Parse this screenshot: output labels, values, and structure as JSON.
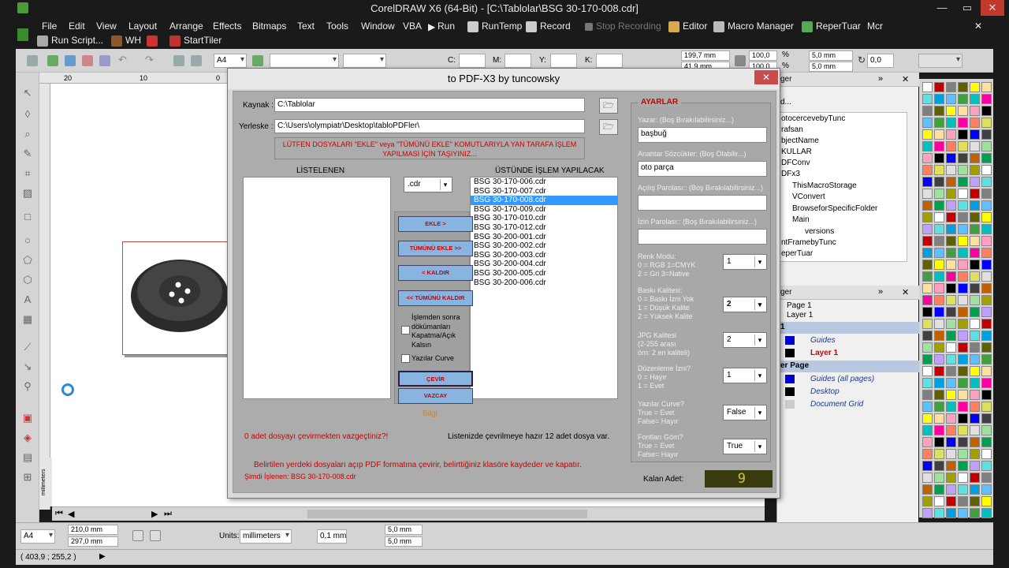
{
  "window": {
    "title": "CorelDRAW X6 (64-Bit) - [C:\\Tablolar\\BSG 30-170-008.cdr]"
  },
  "menu": {
    "items": [
      "File",
      "Edit",
      "View",
      "Layout",
      "Arrange",
      "Effects",
      "Bitmaps",
      "Text",
      "Tools",
      "Window",
      "VBA",
      "Run",
      "RunTemp",
      "Record",
      "Stop Recording",
      "Editor",
      "Macro Manager",
      "ReperTuar",
      "Mcr"
    ],
    "row2": [
      "Run Script...",
      "WH",
      "StartTiler"
    ]
  },
  "propbar": {
    "page_size": "A4",
    "width": "199,7 mm",
    "height": "41,9 mm",
    "scale1": "100,0",
    "scale2": "100,0",
    "nudge1": "5,0 mm",
    "nudge2": "5,0 mm",
    "angle": "0,0",
    "percent": "%",
    "x_label": "C:",
    "m_label": "M:",
    "y_label": "Y:",
    "k_label": "K:"
  },
  "ruler": {
    "t1": "20",
    "t2": "10",
    "t3": "0"
  },
  "bottombar": {
    "page": "A4",
    "w": "210,0 mm",
    "h": "297,0 mm",
    "units_label": "Units:",
    "units": "millimeters",
    "nudge": "0,1 mm",
    "dup1": "5,0 mm",
    "dup2": "5,0 mm",
    "ruler_units": "millimeters"
  },
  "status": {
    "coords": "( 403,9 ; 255,2 )"
  },
  "docker": {
    "tab1": "ger",
    "item_top": "d...",
    "macros": [
      "otocercevebyTunc",
      "rafsan",
      "bjectName",
      "KULLAR",
      "DFConv",
      "DFx3",
      "ThisMacroStorage",
      "VConvert",
      "BrowseforSpecificFolder",
      "Main",
      "versions",
      "ntFramebyTunc",
      "eperTuar"
    ],
    "tab2": "ger",
    "pages": [
      "Page 1",
      "Layer 1"
    ],
    "sec1": "1",
    "layers1": [
      "Guides",
      "Layer 1"
    ],
    "sec2": "er Page",
    "layers2": [
      "Guides (all pages)",
      "Desktop",
      "Document Grid"
    ]
  },
  "dialog": {
    "title": "to PDF-X3 by tuncowsky",
    "close": "✕",
    "kaynak_label": "Kaynak :",
    "kaynak_value": "C:\\Tablolar",
    "yerleske_label": "Yerleske :",
    "yerleske_value": "C:\\Users\\olympiatr\\Desktop\\tabloPDFler\\",
    "warning": "LÜTFEN DOSYALARI \"EKLE\" veya \"TÜMÜNÜ EKLE\" KOMUTLARIYLA YAN TARAFA İŞLEM YAPILMASI İÇİN TAŞIYINIZ...",
    "listed_label": "LİSTELENEN",
    "processing_label": "ÜSTÜNDE İŞLEM YAPILACAK",
    "filter": ".cdr",
    "files": [
      "BSG 30-170-006.cdr",
      "BSG 30-170-007.cdr",
      "BSG 30-170-008.cdr",
      "BSG 30-170-009.cdr",
      "BSG 30-170-010.cdr",
      "BSG 30-170-012.cdr",
      "BSG 30-200-001.cdr",
      "BSG 30-200-002.cdr",
      "BSG 30-200-003.cdr",
      "BSG 30-200-004.cdr",
      "BSG 30-200-005.cdr",
      "BSG 30-200-006.cdr"
    ],
    "selected_file": "BSG 30-170-008.cdr",
    "btn_add": "EKLE >",
    "btn_add_all": "TÜMÜNÜ EKLE >>",
    "btn_remove": "< KALDIR",
    "btn_remove_all": "<< TÜMÜNÜ KALDIR",
    "chk_close": "İşlemden sonra dökümanları Kapatma/Açık Kalsın",
    "chk_curve": "Yazılar Curve",
    "btn_convert": "ÇEVİR",
    "btn_cancel": "VAZCAY",
    "info_link": "Bilgi",
    "msg_cancel": "0 adet dosyayı çevirmekten vazgeçtiniz?!",
    "msg_ready": "Listenizde çevrilmeye hazır 12 adet dosya var.",
    "msg_desc": "Belirtilen yerdeki dosyaları açıp PDF formatına çevirir, belirttiğiniz klasöre kaydeder ve kapatır.",
    "msg_current": "Şimdi İşlenen: BSG 30-170-008.cdr",
    "settings": {
      "title": "AYARLAR",
      "author_label": "Yazar: (Boş Bırakılabilirsiniz...)",
      "author_value": "başbuğ",
      "keywords_label": "Anahtar Sözcükler: (Boş Olabilir...)",
      "keywords_value": "oto parça",
      "openpw_label": "Açılış Parolası:: (Boş Bırakılabilirsiniz...)",
      "openpw_value": "",
      "permpw_label": "İzin Parolası:: (Boş Bırakılabilirsiniz...)",
      "permpw_value": "",
      "color_label1": "Renk Modu:",
      "color_label2": "0 = RGB   1=CMYK",
      "color_label3": "2 = Gri     3=Native",
      "color_value": "1",
      "print_label1": "Baskı Kalitesi:",
      "print_label2": "0 = Baskı İzni Yok",
      "print_label3": "1 = Düşük Kalite",
      "print_label4": "2 = Yüksek Kalite",
      "print_value": "2",
      "jpg_label1": "JPG Kalitesi",
      "jpg_label2": "(2-255 arası",
      "jpg_label3": "örn: 2 en kaliteli)",
      "jpg_value": "2",
      "edit_label1": "Düzenleme İzni?",
      "edit_label2": "0 = Hayır",
      "edit_label3": "1 = Evet",
      "edit_value": "1",
      "curve_label1": "Yazılar Curve?",
      "curve_label2": "True = Evet",
      "curve_label3": "False= Hayır",
      "curve_value": "False",
      "font_label1": "Fontları Göm?",
      "font_label2": "True = Evet",
      "font_label3": "False= Hayır",
      "font_value": "True",
      "remaining_label": "Kalan Adet:",
      "remaining_value": "9"
    }
  }
}
